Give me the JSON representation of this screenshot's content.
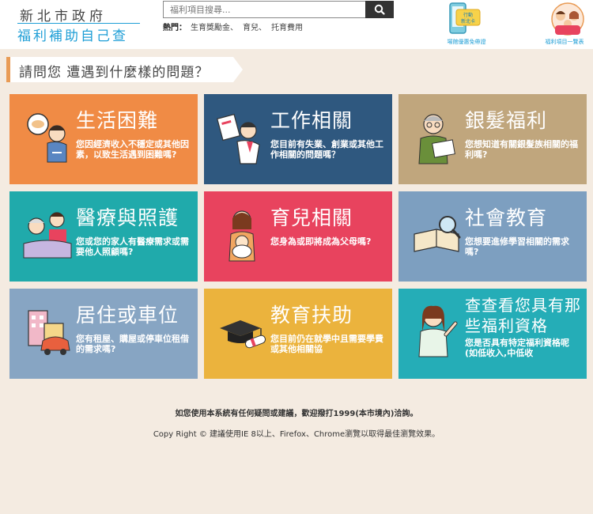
{
  "header": {
    "logo_top": "新北市政府",
    "logo_bottom": "福利補助自己查",
    "search_placeholder": "福利項目搜尋...",
    "hot_label": "熱門：",
    "hot_items": [
      "生育獎勵金、",
      "育兒、",
      "托育費用"
    ],
    "card_promo_label": "場館優惠免帶證",
    "card_text": "行動\n新北卡",
    "list_promo_label": "福利項目一覽表"
  },
  "question": "請問您 遭遇到什麼樣的問題？",
  "tiles": [
    {
      "title": "生活困難",
      "desc": "您因經濟收入不穩定或其他因素，以致生活遇到困難嗎?",
      "color": "#f08b45",
      "icon": "struggling-person-icon"
    },
    {
      "title": "工作相關",
      "desc": "您目前有失業、創業或其他工作相關的問題嗎？",
      "color": "#2f587f",
      "icon": "worker-icon"
    },
    {
      "title": "銀髮福利",
      "desc": "您想知道有關銀髮族相關的福利嗎?",
      "color": "#c0a67d",
      "icon": "elderly-reader-icon"
    },
    {
      "title": "醫療與照護",
      "desc": "您或您的家人有醫療需求或需要他人照顧嗎?",
      "color": "#20aaab",
      "icon": "caregiver-icon"
    },
    {
      "title": "育兒相關",
      "desc": "您身為或即將成為父母嗎?",
      "color": "#e8435e",
      "icon": "mother-baby-icon"
    },
    {
      "title": "社會教育",
      "desc": "您想要進修學習相關的需求嗎?",
      "color": "#7d9fc0",
      "icon": "book-magnifier-icon"
    },
    {
      "title": "居住或車位",
      "desc": "您有租屋、購屋或停車位租借的需求嗎?",
      "color": "#87a5c3",
      "icon": "house-car-icon"
    },
    {
      "title": "教育扶助",
      "desc": "您目前仍在就學中且需要學費或其他相關協",
      "color": "#ebb33d",
      "icon": "graduation-cap-icon"
    },
    {
      "title": "查查看您具有那些福利資格",
      "desc": "您是否具有特定福利資格呢(如低收入,中低收",
      "color": "#25adb7",
      "icon": "pointing-woman-icon"
    }
  ],
  "footer": {
    "line1": "如您使用本系統有任何疑問或建議，歡迎撥打1999(本市境內)洽詢。",
    "line2": "Copy Right © 建議使用IE 8以上、Firefox、Chrome瀏覽以取得最佳瀏覽效果。"
  }
}
